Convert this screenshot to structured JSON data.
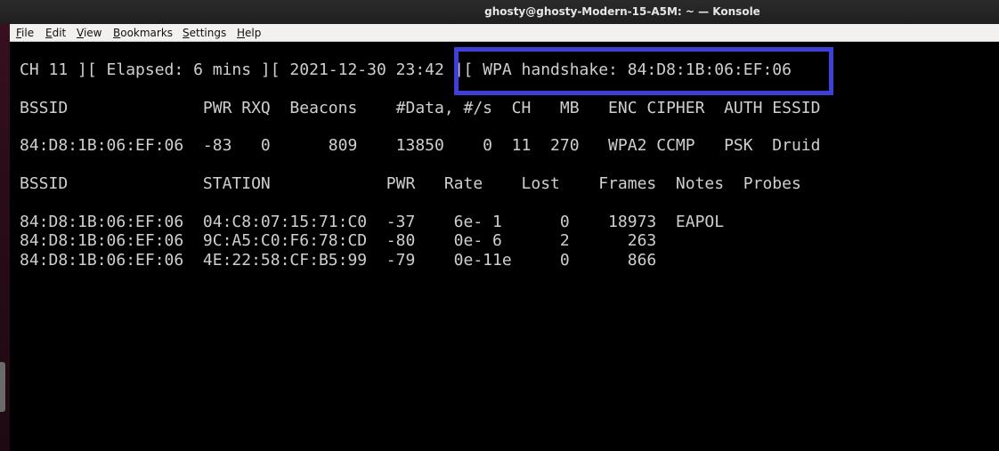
{
  "window": {
    "title": "ghosty@ghosty-Modern-15-A5M: ~ — Konsole"
  },
  "menu": {
    "items": [
      {
        "mnemonic": "F",
        "rest": "ile"
      },
      {
        "mnemonic": "E",
        "rest": "dit"
      },
      {
        "mnemonic": "V",
        "rest": "iew"
      },
      {
        "mnemonic": "B",
        "rest": "ookmarks"
      },
      {
        "mnemonic": "S",
        "rest": "ettings"
      },
      {
        "mnemonic": "H",
        "rest": "elp"
      }
    ]
  },
  "terminal": {
    "status_line": "CH 11 ][ Elapsed: 6 mins ][ 2021-12-30 23:42 ][ WPA handshake: 84:D8:1B:06:EF:06",
    "ap_header": "BSSID              PWR RXQ  Beacons    #Data, #/s  CH   MB   ENC CIPHER  AUTH ESSID",
    "ap_rows": [
      "84:D8:1B:06:EF:06  -83   0      809    13850    0  11  270   WPA2 CCMP   PSK  Druid"
    ],
    "station_header": "BSSID              STATION            PWR   Rate    Lost    Frames  Notes  Probes",
    "station_rows": [
      "84:D8:1B:06:EF:06  04:C8:07:15:71:C0  -37    6e- 1      0    18973  EAPOL",
      "84:D8:1B:06:EF:06  9C:A5:C0:F6:78:CD  -80    0e- 6      2      263",
      "84:D8:1B:06:EF:06  4E:22:58:CF:B5:99  -79    0e-11e     0      866"
    ]
  },
  "colors": {
    "highlight_border": "#3f3fd9",
    "terminal_text": "#cfcfcf",
    "terminal_bg": "#000000"
  }
}
